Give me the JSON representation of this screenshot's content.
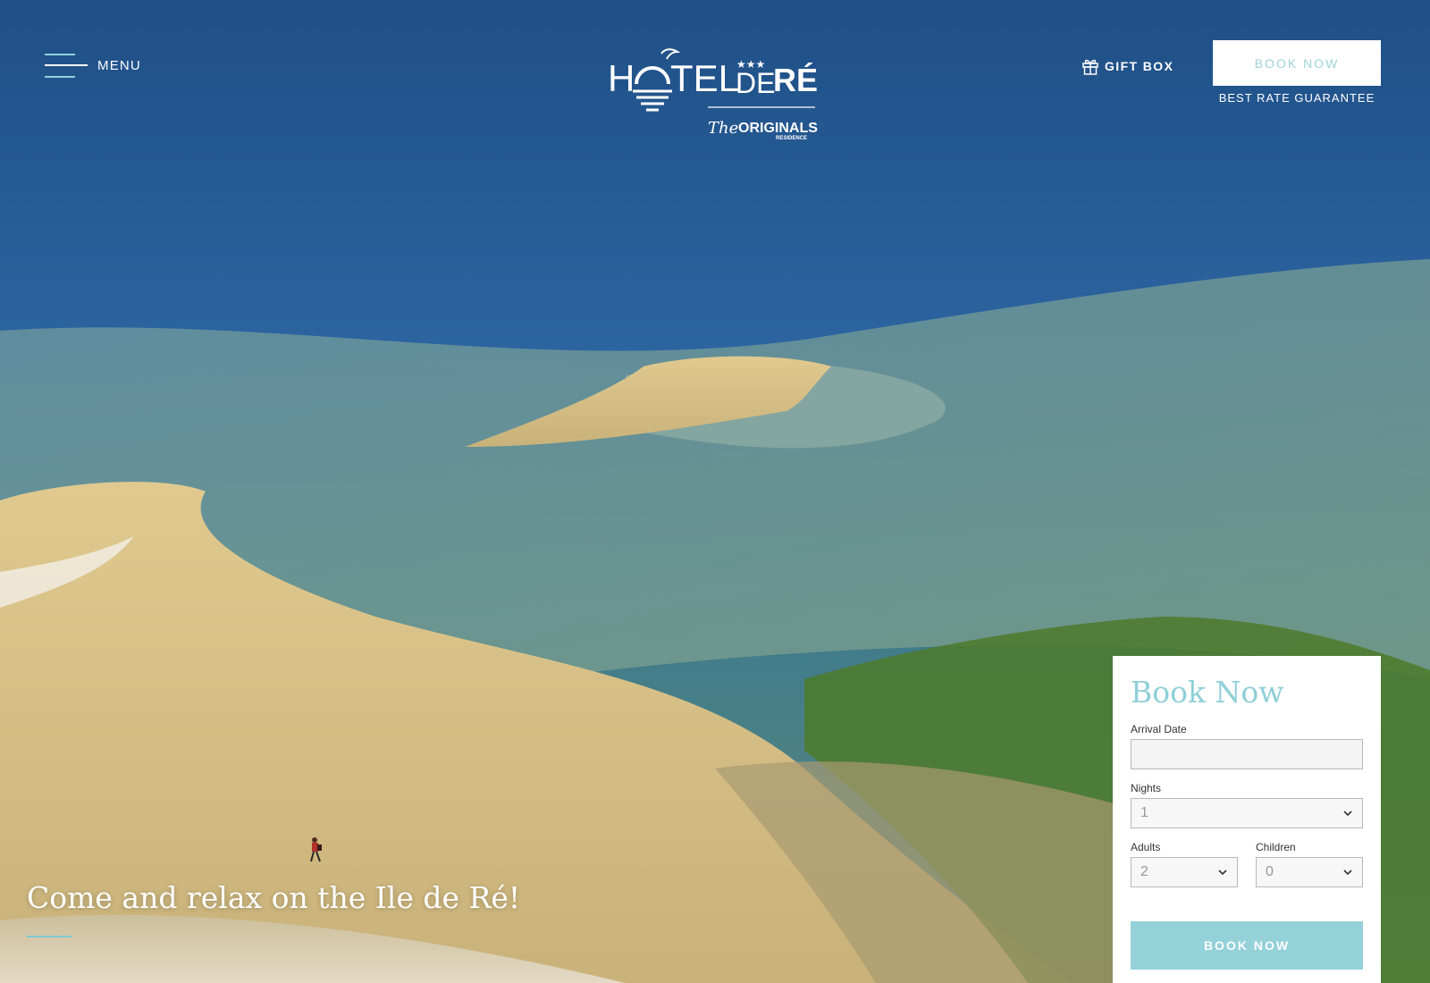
{
  "header": {
    "menu_label": "MENU",
    "gift_label": "GIFT BOX",
    "book_label": "BOOK NOW",
    "rate_label": "BEST RATE GUARANTEE"
  },
  "logo": {
    "name_part1": "H",
    "name_part2": "TEL",
    "name_part3": "DE",
    "name_part4": "RÉ",
    "stars": "★★★",
    "brand_the": "The",
    "brand_originals": "ORIGINALS",
    "brand_residence": "RESIDENCE"
  },
  "hero": {
    "tagline": "Come and relax on the Ile de Ré!"
  },
  "booking": {
    "title": "Book Now",
    "arrival_label": "Arrival Date",
    "arrival_value": "",
    "nights_label": "Nights",
    "nights_value": "1",
    "adults_label": "Adults",
    "adults_value": "2",
    "children_label": "Children",
    "children_value": "0",
    "submit_label": "BOOK NOW"
  },
  "colors": {
    "accent": "#94d1d9",
    "sea_deep": "#2a5d8f",
    "sand": "#d9c28a",
    "seaweed": "#4e7a2a"
  },
  "icons": {
    "menu": "hamburger-icon",
    "gift": "gift-icon",
    "select": "chevron-down-icon"
  }
}
